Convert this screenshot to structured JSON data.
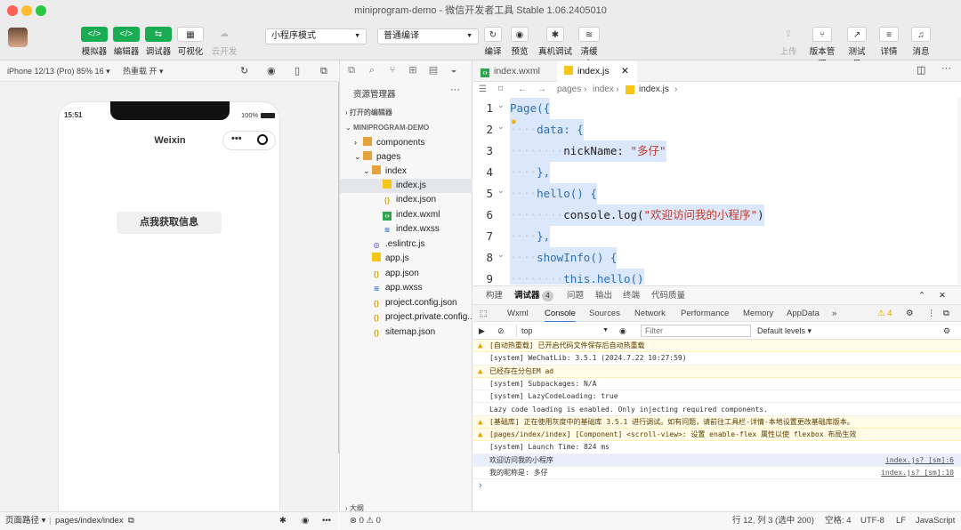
{
  "window": {
    "title": "miniprogram-demo - 微信开发者工具 Stable 1.06.2405010"
  },
  "toolbar": {
    "simulator": "模拟器",
    "editor": "编辑器",
    "debugger": "调试器",
    "visual": "可视化",
    "cloud": "云开发",
    "mode_select": "小程序模式",
    "compile_select": "普通编译",
    "compile": "编译",
    "preview": "预览",
    "real_debug": "真机调试",
    "clear_cache": "清缓存",
    "upload": "上传",
    "version": "版本管理",
    "test_account": "测试号",
    "details": "详情",
    "messages": "消息",
    "icons": {
      "simulator": "</>",
      "editor": "</>",
      "debugger": "⇆",
      "visual": "▦",
      "cloud": "☁"
    }
  },
  "sim": {
    "device": "iPhone 12/13 (Pro) 85% 16 ▾",
    "hot_reload": "热重载 开 ▾",
    "time": "15:51",
    "battery": "100%",
    "nav_title": "Weixin",
    "button": "点我获取信息",
    "status_path_label": "页面路径 ▾",
    "status_path": "pages/index/index"
  },
  "explorer": {
    "title": "资源管理器",
    "open_editors": "打开的编辑器",
    "project": "MINIPROGRAM-DEMO",
    "items": [
      {
        "label": "components",
        "type": "folder"
      },
      {
        "label": "pages",
        "type": "folder"
      },
      {
        "label": "index",
        "type": "folder"
      },
      {
        "label": "index.js",
        "type": "js"
      },
      {
        "label": "index.json",
        "type": "json"
      },
      {
        "label": "index.wxml",
        "type": "wxml"
      },
      {
        "label": "index.wxss",
        "type": "wxss"
      },
      {
        "label": ".eslintrc.js",
        "type": "eslint"
      },
      {
        "label": "app.js",
        "type": "js"
      },
      {
        "label": "app.json",
        "type": "json"
      },
      {
        "label": "app.wxss",
        "type": "wxss"
      },
      {
        "label": "project.config.json",
        "type": "json"
      },
      {
        "label": "project.private.config...",
        "type": "json"
      },
      {
        "label": "sitemap.json",
        "type": "json"
      }
    ],
    "outline": "大纲",
    "problems": "⊗ 0 ⚠ 0"
  },
  "editor": {
    "tabs": [
      "index.wxml",
      "index.js"
    ],
    "breadcrumb": [
      "pages",
      "index",
      "index.js",
      ""
    ],
    "lines": [
      {
        "n": "1",
        "indent": "",
        "text": "Page({"
      },
      {
        "n": "2",
        "indent": "····",
        "text": "data: {"
      },
      {
        "n": "3",
        "indent": "········",
        "key": "nickName: ",
        "str": "\"多仔\""
      },
      {
        "n": "4",
        "indent": "····",
        "text": "},"
      },
      {
        "n": "5",
        "indent": "····",
        "text": "hello() {"
      },
      {
        "n": "6",
        "indent": "········",
        "key": "console.log(",
        "str": "\"欢迎访问我的小程序\"",
        "tail": ")"
      },
      {
        "n": "7",
        "indent": "····",
        "text": "},"
      },
      {
        "n": "8",
        "indent": "····",
        "text": "showInfo() {"
      },
      {
        "n": "9",
        "indent": "········",
        "text": "this.hello()"
      }
    ]
  },
  "devtools": {
    "tabs": [
      "构建",
      "调试器",
      "问题",
      "输出",
      "终端",
      "代码质量"
    ],
    "debugger_badge": "4",
    "inner_tabs": [
      "Wxml",
      "Console",
      "Sources",
      "Network",
      "Performance",
      "Memory",
      "AppData",
      "»"
    ],
    "warn_count": "⚠ 4",
    "context": "top",
    "filter_placeholder": "Filter",
    "levels": "Default levels ▾",
    "logs": [
      {
        "type": "warn",
        "text": "[自动热重载] 已开启代码文件保存后自动热重载"
      },
      {
        "type": "info",
        "text": "[system] WeChatLib: 3.5.1 (2024.7.22 10:27:59)"
      },
      {
        "type": "warn",
        "text": "已经存在分包EM ad"
      },
      {
        "type": "info",
        "text": "[system] Subpackages: N/A"
      },
      {
        "type": "info",
        "text": "[system] LazyCodeLoading: true"
      },
      {
        "type": "info",
        "text": "Lazy code loading is enabled. Only injecting required components."
      },
      {
        "type": "warn",
        "text": "[基础库] 正在使用灰度中的基础库 3.5.1 进行调试。如有问题，请前往工具栏-详情-本地设置更改基础库版本。"
      },
      {
        "type": "warn",
        "text": "[pages/index/index] [Component] <scroll-view>: 设置 enable-flex 属性以使 flexbox 布局生效"
      },
      {
        "type": "info",
        "text": "[system] Launch Time: 824 ms"
      },
      {
        "type": "hl",
        "text": "欢迎访问我的小程序",
        "src": "index.js? [sm]:6"
      },
      {
        "type": "info",
        "text": "我的昵称是: 多仔",
        "src": "index.js? [sm]:10"
      }
    ],
    "prompt": "›"
  },
  "statusbar": {
    "position": "行 12, 列 3 (选中 200)",
    "spaces": "空格: 4",
    "encoding": "UTF-8",
    "eol": "LF",
    "language": "JavaScript"
  }
}
